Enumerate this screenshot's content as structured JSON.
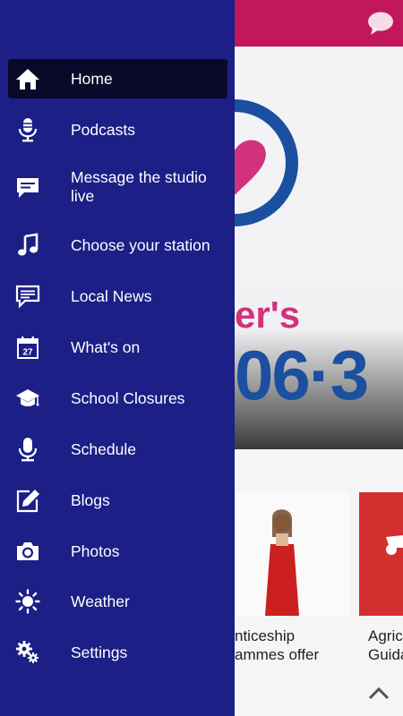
{
  "drawer": {
    "items": [
      {
        "label": "Home",
        "icon": "home-icon",
        "active": true
      },
      {
        "label": "Podcasts",
        "icon": "podcast-mic-icon"
      },
      {
        "label": "Message the studio live",
        "icon": "message-icon"
      },
      {
        "label": "Choose your station",
        "icon": "music-note-icon"
      },
      {
        "label": "Local News",
        "icon": "news-chat-icon"
      },
      {
        "label": "What's on",
        "icon": "calendar-icon",
        "calendar_day": "27"
      },
      {
        "label": "School Closures",
        "icon": "graduation-cap-icon"
      },
      {
        "label": "Schedule",
        "icon": "microphone-icon"
      },
      {
        "label": "Blogs",
        "icon": "edit-icon"
      },
      {
        "label": "Photos",
        "icon": "camera-icon"
      },
      {
        "label": "Weather",
        "icon": "sun-icon"
      },
      {
        "label": "Settings",
        "icon": "gear-icon"
      }
    ]
  },
  "background": {
    "hero_text_1": "er's",
    "hero_text_2": "06·3",
    "captions": [
      "nticeship\nammes offer",
      "Agric\nGuida"
    ]
  },
  "colors": {
    "drawer_bg": "#1b1f86",
    "active_item_bg": "#090a2a",
    "topbar": "#c2185b",
    "brand_pink": "#d2317b",
    "brand_blue": "#1b4fa0"
  }
}
